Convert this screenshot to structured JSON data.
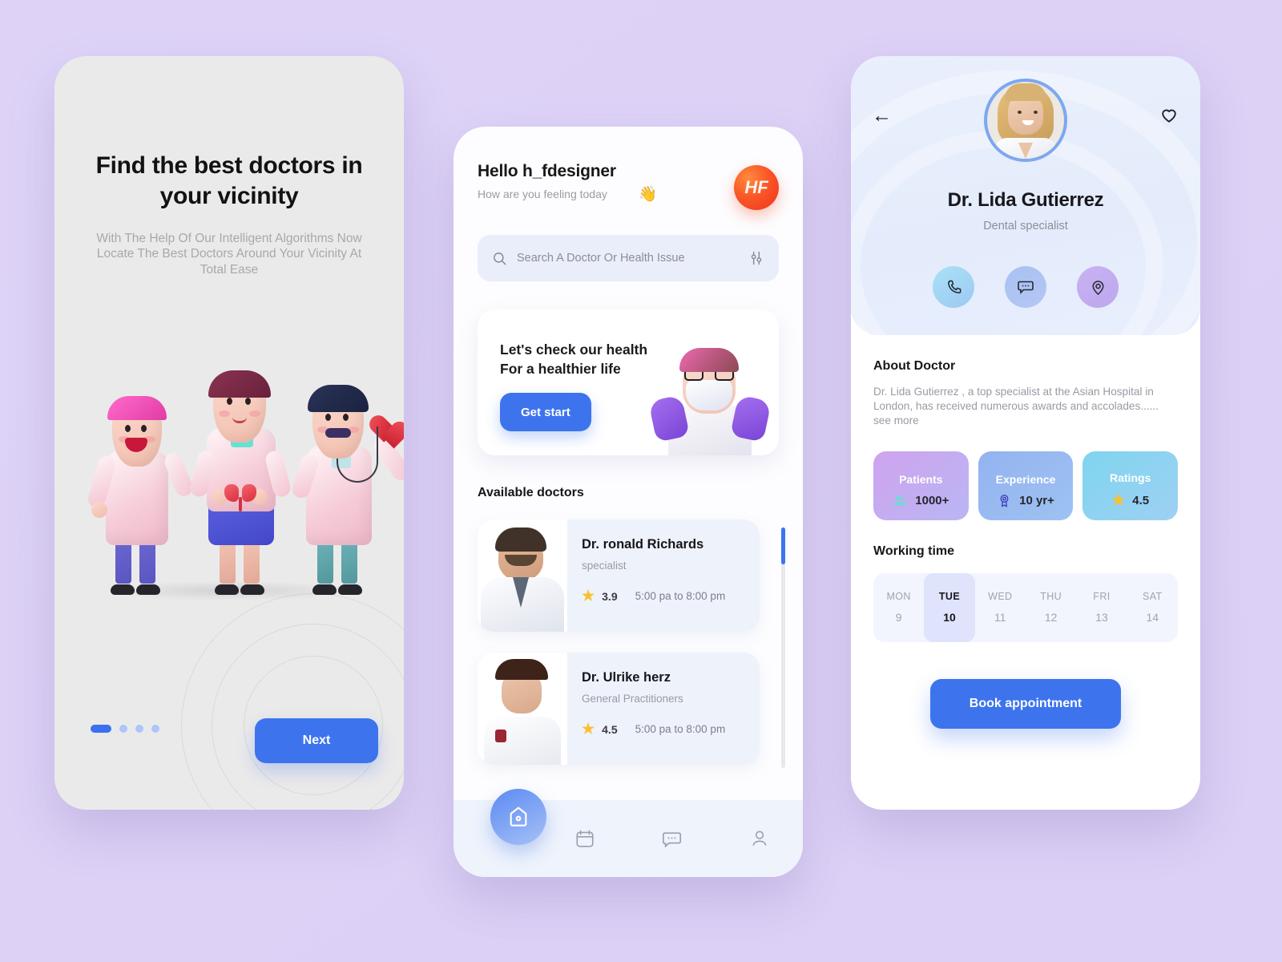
{
  "onboarding": {
    "title": "Find the best doctors in your vicinity",
    "subtitle": "With The Help Of Our Intelligent Algorithms Now Locate The Best Doctors Around Your Vicinity At Total Ease",
    "next_label": "Next",
    "pagination": {
      "total": 4,
      "active_index": 0
    }
  },
  "home": {
    "greeting": "Hello h_fdesigner",
    "greeting_emoji": "👋",
    "greeting_sub": "How are you feeling today",
    "avatar_initials": "HF",
    "search": {
      "placeholder": "Search A Doctor Or Health Issue",
      "value": ""
    },
    "promo": {
      "line1": "Let's check our health",
      "line2": "For a healthier life",
      "cta": "Get start"
    },
    "section_title": "Available doctors",
    "doctors": [
      {
        "name": "Dr. ronald Richards",
        "specialty": "specialist",
        "rating": "3.9",
        "hours": "5:00 pa to 8:00 pm"
      },
      {
        "name": "Dr. Ulrike herz",
        "specialty": "General Practitioners",
        "rating": "4.5",
        "hours": "5:00 pa to 8:00 pm"
      }
    ],
    "tabs": [
      {
        "name": "home",
        "icon": "home-icon",
        "active": true
      },
      {
        "name": "calendar",
        "icon": "calendar-icon",
        "active": false
      },
      {
        "name": "messages",
        "icon": "chat-icon",
        "active": false
      },
      {
        "name": "profile",
        "icon": "person-icon",
        "active": false
      }
    ]
  },
  "profile": {
    "doctor_name": "Dr. Lida Gutierrez",
    "doctor_role": "Dental specialist",
    "actions": [
      {
        "name": "call",
        "icon": "phone-icon"
      },
      {
        "name": "chat",
        "icon": "chat-icon"
      },
      {
        "name": "location",
        "icon": "location-pin-icon"
      }
    ],
    "about_heading": "About Doctor",
    "about_text": "Dr. Lida Gutierrez , a top specialist at the Asian Hospital in London, has received numerous awards and accolades...... see more",
    "stats": [
      {
        "label": "Patients",
        "value": "1000+",
        "icon": "people-icon",
        "color": "#cfa3ef"
      },
      {
        "label": "Experience",
        "value": "10 yr+",
        "icon": "medal-icon",
        "color": "#93b3ef"
      },
      {
        "label": "Ratings",
        "value": "4.5",
        "icon": "star-icon",
        "color": "#7fd5ef"
      }
    ],
    "working_time_heading": "Working time",
    "days": [
      {
        "name": "MON",
        "date": "9",
        "selected": false
      },
      {
        "name": "TUE",
        "date": "10",
        "selected": true
      },
      {
        "name": "WED",
        "date": "11",
        "selected": false
      },
      {
        "name": "THU",
        "date": "12",
        "selected": false
      },
      {
        "name": "FRI",
        "date": "13",
        "selected": false
      },
      {
        "name": "SAT",
        "date": "14",
        "selected": false
      }
    ],
    "book_label": "Book appointment"
  },
  "colors": {
    "background": "#ddd2f6",
    "primary": "#3d74ee",
    "star": "#fbc02d",
    "avatar_gradient_start": "#ff8a3d",
    "avatar_gradient_end": "#f0331f"
  }
}
